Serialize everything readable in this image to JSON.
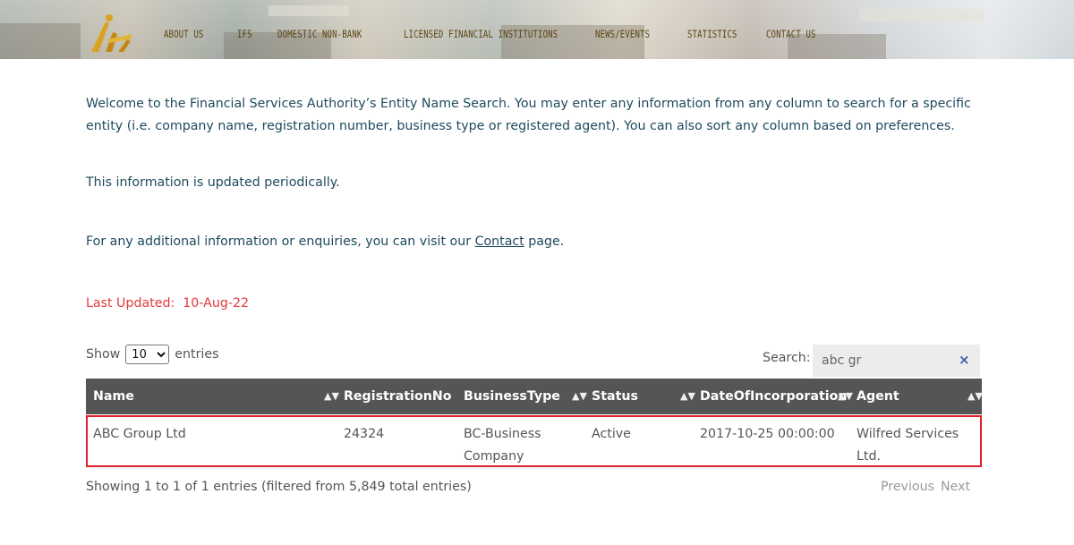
{
  "header": {
    "nav": [
      {
        "label": "ABOUT US",
        "name": "nav-about-us"
      },
      {
        "label": "IFS",
        "name": "nav-ifs"
      },
      {
        "label": "DOMESTIC NON-BANK",
        "name": "nav-domestic-non-bank"
      },
      {
        "label": "LICENSED FINANCIAL INSTITUTIONS",
        "name": "nav-licensed-financial-institutions"
      },
      {
        "label": "NEWS/EVENTS",
        "name": "nav-news-events"
      },
      {
        "label": "STATISTICS",
        "name": "nav-statistics"
      },
      {
        "label": "CONTACT US",
        "name": "nav-contact-us"
      }
    ],
    "logo_color": "#d9a21f"
  },
  "intro": {
    "text": "Welcome to the Financial Services Authority’s Entity Name Search. You may enter any information from any column to search for a specific entity (i.e. company name, registration number, business type or registered agent). You can also sort any column based on preferences.",
    "updated_note": "This information is updated periodically.",
    "enquiries_prefix": "For any additional information or enquiries, you can visit our ",
    "contact_link": "Contact",
    "enquiries_suffix": " page.",
    "last_updated_label": "Last Updated:",
    "last_updated_value": "10-Aug-22"
  },
  "controls": {
    "show_label": "Show",
    "entries_label": "entries",
    "page_size": "10",
    "search_label": "Search:",
    "search_value": "abc gr",
    "clear_icon": "×"
  },
  "table": {
    "columns": [
      "Name",
      "RegistrationNo",
      "BusinessType",
      "Status",
      "DateOfIncorporation",
      "Agent"
    ],
    "rows": [
      {
        "name": "ABC Group Ltd",
        "registration_no": "24324",
        "business_type_1": "BC-Business",
        "business_type_2": "Company",
        "status": "Active",
        "date": "2017-10-25 00:00:00",
        "agent_1": "Wilfred Services",
        "agent_2": "Ltd."
      }
    ],
    "highlight_color": "#e0202a",
    "header_bg": "#555555"
  },
  "footer": {
    "info": "Showing 1 to 1 of 1 entries (filtered from 5,849 total entries)",
    "previous": "Previous",
    "next": "Next"
  }
}
